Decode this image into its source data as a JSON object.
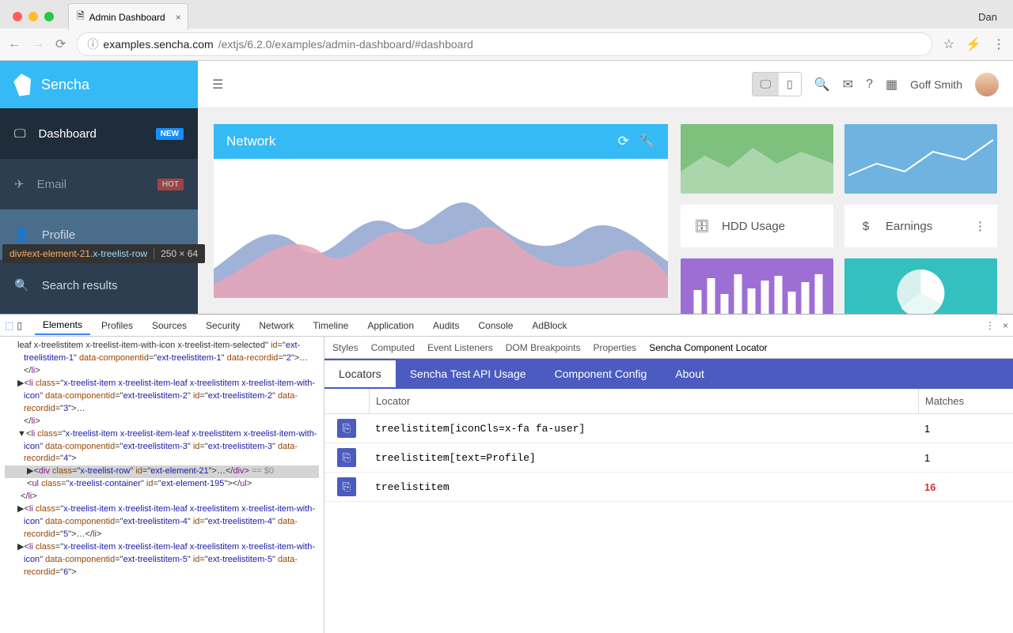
{
  "browser": {
    "tab_title": "Admin Dashboard",
    "user": "Dan",
    "url_host": "examples.sencha.com",
    "url_path": "/extjs/6.2.0/examples/admin-dashboard/#dashboard"
  },
  "app": {
    "brand": "Sencha",
    "topbar": {
      "username": "Goff Smith"
    },
    "sidebar": {
      "dashboard": "Dashboard",
      "dashboard_badge": "NEW",
      "email": "Email",
      "email_badge": "HOT",
      "profile": "Profile",
      "search": "Search results"
    },
    "inspect_tip": {
      "id": "div#ext-element-21",
      "cls": ".x-treelist-row",
      "dims": "250 × 64"
    },
    "panels": {
      "network": "Network",
      "hdd": "HDD Usage",
      "earnings": "Earnings"
    }
  },
  "devtools": {
    "tabs": [
      "Elements",
      "Profiles",
      "Sources",
      "Security",
      "Network",
      "Timeline",
      "Application",
      "Audits",
      "Console",
      "AdBlock"
    ],
    "style_tabs": [
      "Styles",
      "Computed",
      "Event Listeners",
      "DOM Breakpoints",
      "Properties",
      "Sencha Component Locator"
    ],
    "locator_tabs": [
      "Locators",
      "Sencha Test API Usage",
      "Component Config",
      "About"
    ],
    "table": {
      "col_locator": "Locator",
      "col_matches": "Matches",
      "rows": [
        {
          "locator": "treelistitem[iconCls=x-fa fa-user]",
          "matches": "1"
        },
        {
          "locator": "treelistitem[text=Profile]",
          "matches": "1"
        },
        {
          "locator": "treelistitem",
          "matches": "16"
        }
      ]
    },
    "dom_snippet": {
      "l1": "leaf x-treelistitem x-treelist-item-with-icon x-treelist-item-selected",
      "l1b": "ext-treelistitem-1",
      "l1c": "ext-treelistitem-1",
      "l1d": "2",
      "l2cls": "x-treelist-item x-treelist-item-leaf x-treelistitem x-treelist-item-with-icon",
      "l2cid": "ext-treelistitem-2",
      "l2id": "ext-treelistitem-2",
      "l2rec": "3",
      "l3cls": "x-treelist-item x-treelist-item-leaf x-treelistitem x-treelist-item-with-icon",
      "l3cid": "ext-treelistitem-3",
      "l3id": "ext-treelistitem-3",
      "l3rec": "4",
      "divcls": "x-treelist-row",
      "divid": "ext-element-21",
      "ulcls": "x-treelist-container",
      "ulid": "ext-element-195",
      "l4cls": "x-treelist-item x-treelist-item-leaf x-treelistitem x-treelist-item-with-icon",
      "l4cid": "ext-treelistitem-4",
      "l4id": "ext-treelistitem-4",
      "l4rec": "5",
      "l5cls": "x-treelist-item x-treelist-item-leaf x-treelistitem x-treelist-item-with-icon",
      "l5cid": "ext-treelistitem-5",
      "l5id": "ext-treelistitem-5",
      "l5rec": "6"
    }
  }
}
